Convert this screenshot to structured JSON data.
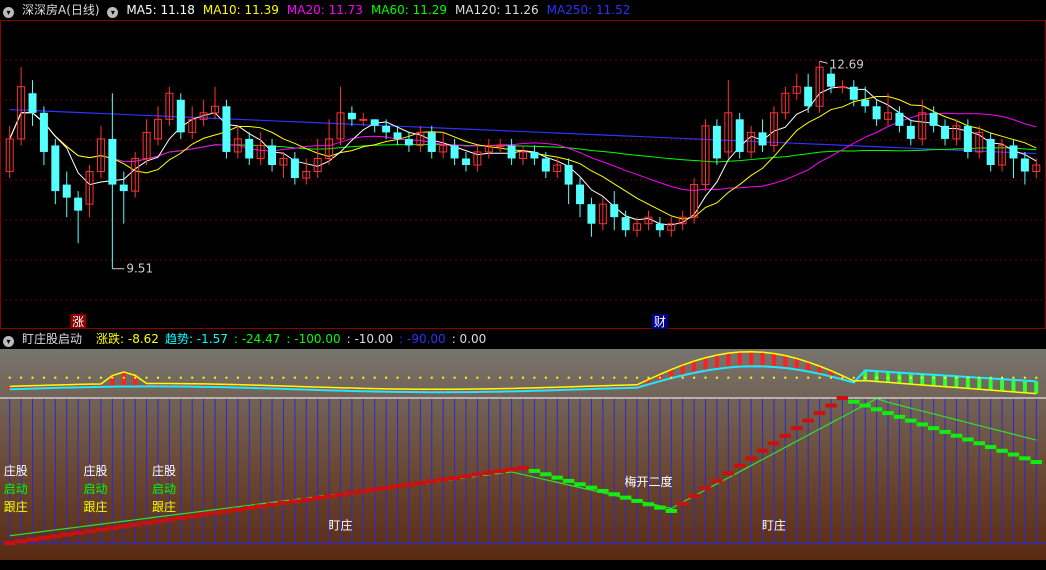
{
  "header": {
    "stock_name": "深深房A",
    "period": "(日线)",
    "ma": [
      {
        "label": "MA5: 11.18",
        "color": "#ffffff"
      },
      {
        "label": "MA10: 11.39",
        "color": "#ffff00"
      },
      {
        "label": "MA20: 11.73",
        "color": "#ff00ff"
      },
      {
        "label": "MA60: 11.29",
        "color": "#00ff00"
      },
      {
        "label": "MA120: 11.26",
        "color": "#dddddd"
      },
      {
        "label": "MA250: 11.52",
        "color": "#3030ff"
      }
    ]
  },
  "indicator": {
    "name": "盯庄股启动",
    "items": [
      {
        "label": "涨跌: -8.62",
        "color": "#ffff00"
      },
      {
        "label": "趋势: -1.57",
        "color": "#00ffff"
      },
      {
        "label": ": -24.47",
        "color": "#00ff00"
      },
      {
        "label": ": -100.00",
        "color": "#00ff00"
      },
      {
        "label": ": -10.00",
        "color": "#dddddd"
      },
      {
        "label": ": -90.00",
        "color": "#3030ff"
      },
      {
        "label": ": 0.00",
        "color": "#dddddd"
      }
    ]
  },
  "chart_data": {
    "type": "candlestick",
    "ylim": [
      9.0,
      13.2
    ],
    "high_label": "12.69",
    "low_label": "9.51",
    "markers": [
      {
        "text": "涨",
        "index": 6
      },
      {
        "text": "财",
        "index": 57
      }
    ],
    "ma_colors": {
      "ma5": "#ffffff",
      "ma10": "#ffff00",
      "ma20": "#ff00ff",
      "ma60": "#00ff00",
      "ma250": "#3030ff"
    },
    "candles": [
      [
        11.0,
        11.5,
        11.7,
        10.9
      ],
      [
        11.5,
        12.3,
        12.6,
        11.4
      ],
      [
        12.2,
        11.9,
        12.4,
        11.7
      ],
      [
        11.9,
        11.3,
        12.0,
        11.1
      ],
      [
        11.4,
        10.7,
        11.5,
        10.5
      ],
      [
        10.8,
        10.6,
        11.0,
        10.3
      ],
      [
        10.6,
        10.4,
        10.7,
        9.9
      ],
      [
        10.5,
        11.0,
        11.1,
        10.3
      ],
      [
        11.0,
        11.5,
        11.7,
        10.9
      ],
      [
        11.5,
        10.8,
        12.2,
        9.51
      ],
      [
        10.8,
        10.7,
        11.0,
        10.2
      ],
      [
        10.7,
        11.2,
        11.3,
        10.6
      ],
      [
        11.2,
        11.6,
        11.8,
        11.1
      ],
      [
        11.5,
        11.8,
        12.0,
        11.4
      ],
      [
        11.8,
        12.2,
        12.3,
        11.7
      ],
      [
        12.1,
        11.6,
        12.2,
        11.5
      ],
      [
        11.6,
        11.8,
        12.0,
        11.5
      ],
      [
        11.8,
        11.9,
        12.1,
        11.7
      ],
      [
        11.9,
        12.0,
        12.3,
        11.8
      ],
      [
        12.0,
        11.3,
        12.1,
        11.2
      ],
      [
        11.3,
        11.5,
        11.7,
        11.2
      ],
      [
        11.5,
        11.2,
        11.6,
        11.1
      ],
      [
        11.2,
        11.4,
        11.6,
        11.1
      ],
      [
        11.4,
        11.1,
        11.5,
        11.0
      ],
      [
        11.1,
        11.2,
        11.3,
        10.9
      ],
      [
        11.2,
        10.9,
        11.3,
        10.8
      ],
      [
        10.9,
        11.0,
        11.2,
        10.8
      ],
      [
        11.0,
        11.2,
        11.5,
        10.9
      ],
      [
        11.2,
        11.5,
        11.8,
        11.1
      ],
      [
        11.5,
        11.9,
        12.3,
        11.4
      ],
      [
        11.9,
        11.8,
        12.0,
        11.7
      ],
      [
        11.8,
        11.8,
        11.9,
        11.7
      ],
      [
        11.8,
        11.7,
        11.8,
        11.6
      ],
      [
        11.7,
        11.6,
        11.8,
        11.5
      ],
      [
        11.6,
        11.5,
        11.7,
        11.4
      ],
      [
        11.5,
        11.4,
        11.6,
        11.3
      ],
      [
        11.4,
        11.6,
        11.7,
        11.3
      ],
      [
        11.6,
        11.3,
        11.7,
        11.2
      ],
      [
        11.3,
        11.4,
        11.6,
        11.2
      ],
      [
        11.4,
        11.2,
        11.5,
        11.1
      ],
      [
        11.2,
        11.1,
        11.3,
        11.0
      ],
      [
        11.1,
        11.3,
        11.4,
        11.0
      ],
      [
        11.3,
        11.4,
        11.5,
        11.2
      ],
      [
        11.4,
        11.4,
        11.5,
        11.3
      ],
      [
        11.4,
        11.2,
        11.5,
        11.1
      ],
      [
        11.2,
        11.3,
        11.4,
        11.1
      ],
      [
        11.3,
        11.2,
        11.4,
        11.1
      ],
      [
        11.2,
        11.0,
        11.3,
        10.9
      ],
      [
        11.0,
        11.1,
        11.2,
        10.9
      ],
      [
        11.1,
        10.8,
        11.2,
        10.5
      ],
      [
        10.8,
        10.5,
        10.9,
        10.3
      ],
      [
        10.5,
        10.2,
        10.6,
        10.0
      ],
      [
        10.2,
        10.5,
        10.6,
        10.1
      ],
      [
        10.5,
        10.3,
        10.7,
        10.1
      ],
      [
        10.3,
        10.1,
        10.4,
        10.0
      ],
      [
        10.1,
        10.2,
        10.3,
        10.0
      ],
      [
        10.2,
        10.3,
        10.4,
        10.1
      ],
      [
        10.2,
        10.1,
        10.3,
        10.0
      ],
      [
        10.1,
        10.2,
        10.3,
        10.0
      ],
      [
        10.2,
        10.3,
        10.4,
        10.1
      ],
      [
        10.3,
        10.8,
        10.9,
        10.2
      ],
      [
        10.8,
        11.7,
        11.8,
        10.7
      ],
      [
        11.7,
        11.2,
        11.8,
        11.1
      ],
      [
        11.3,
        11.9,
        12.4,
        11.2
      ],
      [
        11.8,
        11.3,
        11.9,
        11.2
      ],
      [
        11.3,
        11.6,
        11.7,
        11.2
      ],
      [
        11.6,
        11.4,
        11.8,
        11.3
      ],
      [
        11.4,
        11.9,
        12.0,
        11.3
      ],
      [
        11.9,
        12.2,
        12.3,
        11.8
      ],
      [
        12.2,
        12.3,
        12.5,
        12.1
      ],
      [
        12.3,
        12.0,
        12.5,
        11.9
      ],
      [
        12.0,
        12.6,
        12.69,
        11.9
      ],
      [
        12.5,
        12.3,
        12.6,
        12.2
      ],
      [
        12.3,
        12.3,
        12.4,
        12.2
      ],
      [
        12.3,
        12.1,
        12.4,
        12.0
      ],
      [
        12.1,
        12.0,
        12.3,
        11.9
      ],
      [
        12.0,
        11.8,
        12.1,
        11.7
      ],
      [
        11.8,
        11.9,
        12.2,
        11.7
      ],
      [
        11.9,
        11.7,
        12.0,
        11.6
      ],
      [
        11.7,
        11.5,
        11.8,
        11.4
      ],
      [
        11.5,
        11.9,
        12.1,
        11.4
      ],
      [
        11.9,
        11.7,
        12.0,
        11.6
      ],
      [
        11.7,
        11.5,
        11.8,
        11.4
      ],
      [
        11.5,
        11.7,
        11.8,
        11.4
      ],
      [
        11.7,
        11.3,
        11.8,
        11.2
      ],
      [
        11.3,
        11.6,
        11.7,
        11.2
      ],
      [
        11.5,
        11.1,
        11.6,
        11.0
      ],
      [
        11.1,
        11.4,
        11.5,
        11.0
      ],
      [
        11.4,
        11.2,
        11.5,
        10.9
      ],
      [
        11.2,
        11.0,
        11.3,
        10.8
      ],
      [
        11.0,
        11.1,
        11.2,
        10.9
      ]
    ]
  },
  "indicator_chart": {
    "labels": [
      {
        "text": "庄股",
        "color": "#ffffff",
        "index": 0,
        "row": 0
      },
      {
        "text": "启动",
        "color": "#00ff00",
        "index": 0,
        "row": 1
      },
      {
        "text": "跟庄",
        "color": "#ffff00",
        "index": 0,
        "row": 2
      },
      {
        "text": "庄股",
        "color": "#ffffff",
        "index": 7,
        "row": 0
      },
      {
        "text": "启动",
        "color": "#00ff00",
        "index": 7,
        "row": 1
      },
      {
        "text": "跟庄",
        "color": "#ffff00",
        "index": 7,
        "row": 2
      },
      {
        "text": "庄股",
        "color": "#ffffff",
        "index": 13,
        "row": 0
      },
      {
        "text": "启动",
        "color": "#00ff00",
        "index": 13,
        "row": 1
      },
      {
        "text": "跟庄",
        "color": "#ffff00",
        "index": 13,
        "row": 2
      }
    ],
    "annotations": [
      {
        "text": "盯庄",
        "index": 29,
        "level": -88
      },
      {
        "text": "盯庄",
        "index": 67,
        "level": -88
      },
      {
        "text": "梅开二度",
        "index": 56,
        "level": -58
      }
    ]
  }
}
